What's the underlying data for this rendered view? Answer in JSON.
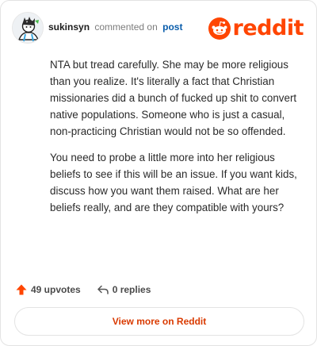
{
  "header": {
    "username": "sukinsyn",
    "action_text": "commented on",
    "post_link": "post",
    "logo_text": "reddit"
  },
  "comment": {
    "paragraphs": [
      "NTA but tread carefully. She may be more religious than you realize. It's literally a fact that Christian missionaries did a bunch of fucked up shit to convert native populations. Someone who is just a casual, non-practicing Christian would not be so offended.",
      "You need to probe a little more into her religious beliefs to see if this will be an issue. If you want kids, discuss how you want them raised. What are her beliefs really, and are they compatible with yours?"
    ]
  },
  "actions": {
    "upvotes": "49 upvotes",
    "replies": "0 replies"
  },
  "footer": {
    "view_more": "View more on Reddit"
  },
  "colors": {
    "brand": "#ff4500",
    "link": "#0a5dab",
    "view_more": "#d93a00"
  },
  "icons": {
    "avatar": "user-avatar",
    "logo": "reddit-snoo-icon",
    "upvote": "upvote-arrow-icon",
    "reply": "reply-arrow-icon"
  }
}
